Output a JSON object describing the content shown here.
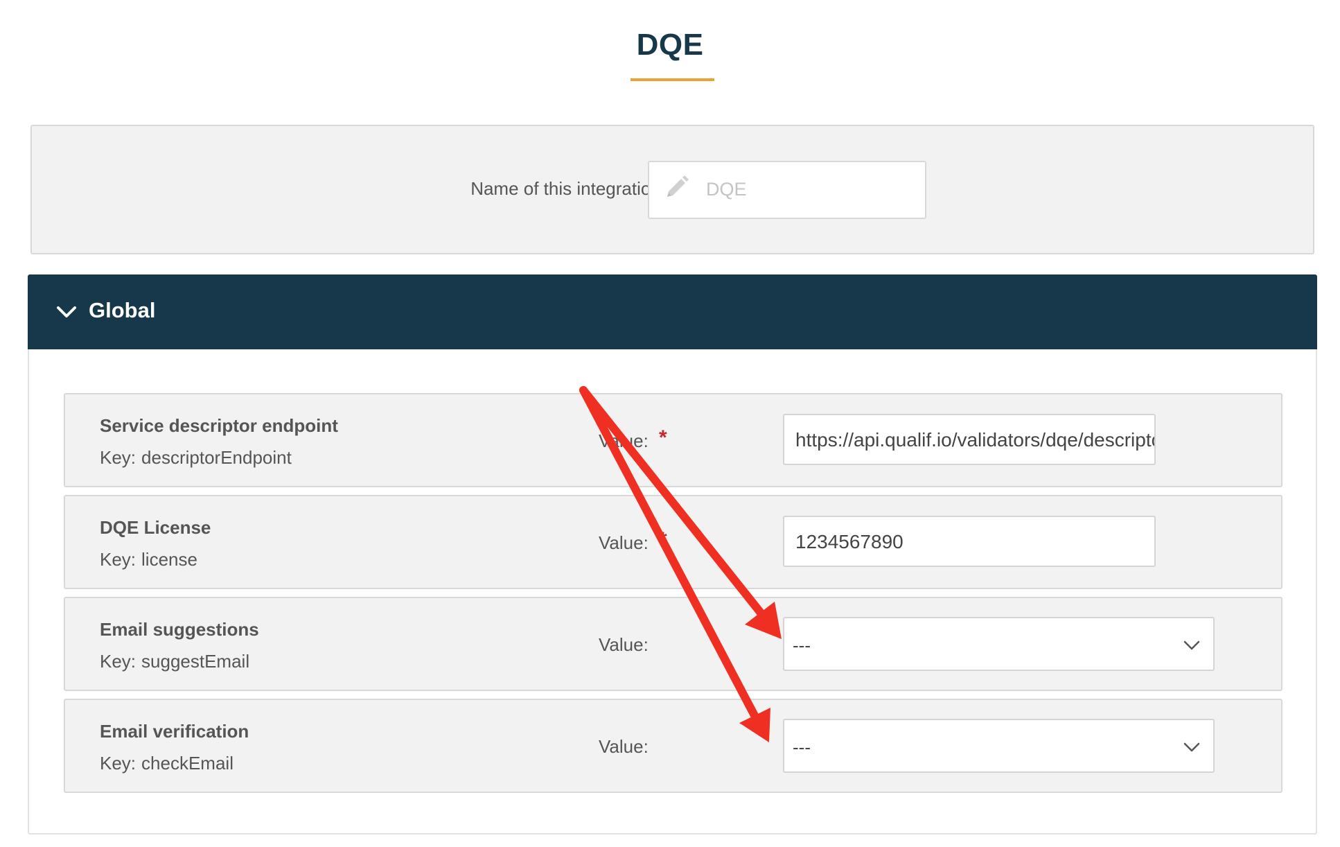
{
  "page": {
    "title": "DQE"
  },
  "integration": {
    "name_label": "Name of this integration:",
    "name_value": "DQE"
  },
  "section": {
    "title": "Global"
  },
  "params": [
    {
      "title": "Service descriptor endpoint",
      "key_label": "Key:",
      "key": "descriptorEndpoint",
      "value_label": "Value:",
      "required": "*",
      "value": "https://api.qualif.io/validators/dqe/descriptor"
    },
    {
      "title": "DQE License",
      "key_label": "Key:",
      "key": "license",
      "value_label": "Value:",
      "required": "*",
      "value": "1234567890"
    },
    {
      "title": "Email suggestions",
      "key_label": "Key:",
      "key": "suggestEmail",
      "value_label": "Value:",
      "selected": "---"
    },
    {
      "title": "Email verification",
      "key_label": "Key:",
      "key": "checkEmail",
      "value_label": "Value:",
      "selected": "---"
    }
  ],
  "colors": {
    "accent": "#f0a030",
    "header": "#17374a",
    "required": "#c7272f",
    "annotation_arrow": "#f02f23"
  },
  "icons": [
    "pencil-icon",
    "chevron-down-icon",
    "dropdown-chevron-icon"
  ]
}
